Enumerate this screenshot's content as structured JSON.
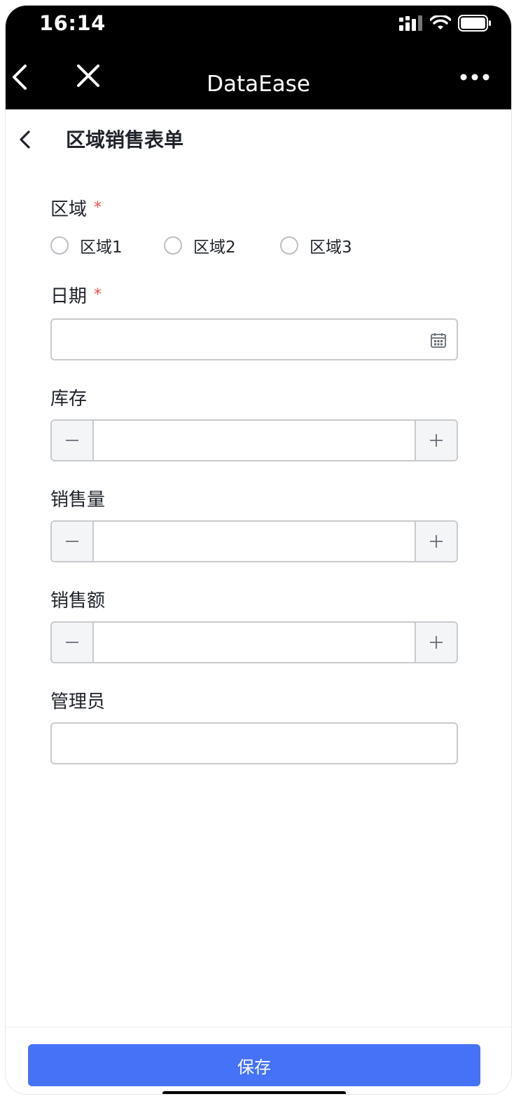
{
  "status_bar": {
    "time": "16:14"
  },
  "nav": {
    "title": "DataEase"
  },
  "page": {
    "title": "区域销售表单"
  },
  "form": {
    "region": {
      "label": "区域",
      "required_mark": "*",
      "options": [
        "区域1",
        "区域2",
        "区域3"
      ]
    },
    "date": {
      "label": "日期",
      "required_mark": "*",
      "value": ""
    },
    "inventory": {
      "label": "库存",
      "value": ""
    },
    "sales_volume": {
      "label": "销售量",
      "value": ""
    },
    "sales_amount": {
      "label": "销售额",
      "value": ""
    },
    "manager": {
      "label": "管理员",
      "value": ""
    }
  },
  "actions": {
    "save_label": "保存"
  },
  "colors": {
    "accent": "#4572f7",
    "required": "#f54a45",
    "nav_bg": "#000000"
  },
  "icons": [
    "signal-icon",
    "wifi-icon",
    "battery-icon",
    "back-icon",
    "close-icon",
    "more-icon",
    "calendar-icon",
    "minus-icon",
    "plus-icon"
  ]
}
